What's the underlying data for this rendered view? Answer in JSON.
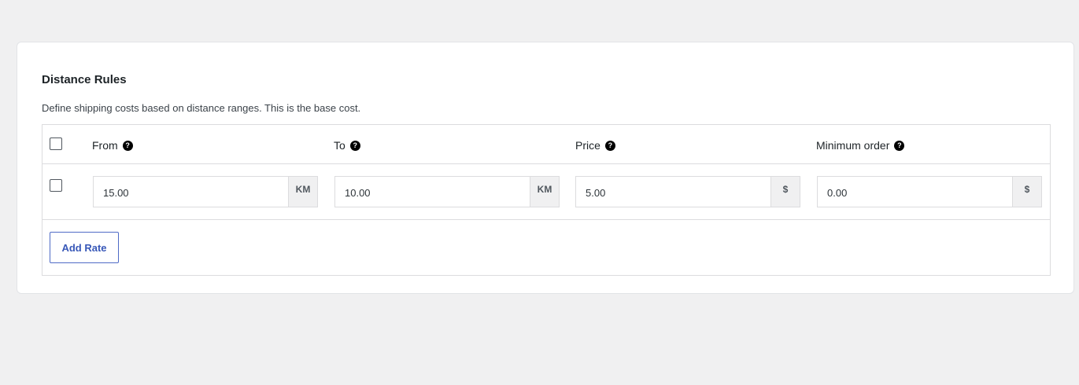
{
  "section": {
    "title": "Distance Rules",
    "description": "Define shipping costs based on distance ranges. This is the base cost."
  },
  "table": {
    "columns": [
      {
        "label": "From",
        "help_icon": "?"
      },
      {
        "label": "To",
        "help_icon": "?"
      },
      {
        "label": "Price",
        "help_icon": "?"
      },
      {
        "label": "Minimum order",
        "help_icon": "?"
      }
    ],
    "rows": [
      {
        "selected": false,
        "from": {
          "value": "15.00",
          "unit": "KM"
        },
        "to": {
          "value": "10.00",
          "unit": "KM"
        },
        "price": {
          "value": "5.00",
          "unit": "$"
        },
        "min_order": {
          "value": "0.00",
          "unit": "$"
        }
      }
    ]
  },
  "actions": {
    "add_rate_label": "Add Rate"
  },
  "colors": {
    "accent": "#3858b8",
    "page_background": "#f0f0f1",
    "card_background": "#ffffff"
  }
}
